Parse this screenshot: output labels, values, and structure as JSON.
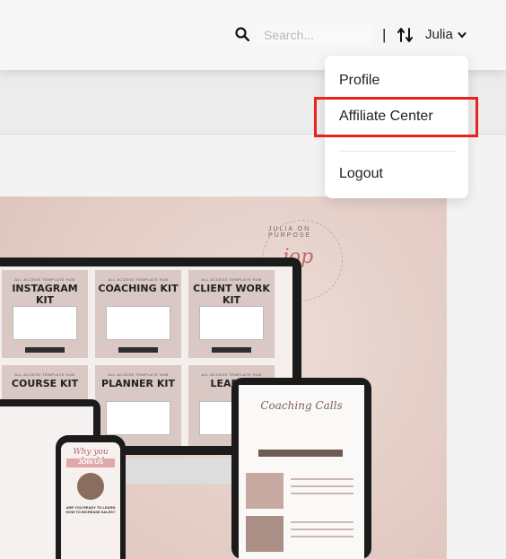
{
  "header": {
    "search_placeholder": "Search...",
    "separator": "|",
    "user_name": "Julia"
  },
  "user_dropdown": {
    "items": [
      {
        "label": "Profile"
      },
      {
        "label": "Affiliate Center"
      },
      {
        "label": "Logout"
      }
    ],
    "highlighted_item": "Affiliate Center",
    "highlight_color": "#e8231c"
  },
  "hero": {
    "seal_text": "JULIA ON PURPOSE",
    "seal_monogram": "jop",
    "kits": [
      {
        "small": "ALL ACCESS TEMPLATE HUB",
        "title": "INSTAGRAM KIT"
      },
      {
        "small": "ALL ACCESS TEMPLATE HUB",
        "title": "COACHING KIT"
      },
      {
        "small": "ALL ACCESS TEMPLATE HUB",
        "title": "CLIENT WORK KIT"
      },
      {
        "small": "ALL ACCESS TEMPLATE HUB",
        "title": "COURSE KIT"
      },
      {
        "small": "ALL ACCESS TEMPLATE HUB",
        "title": "PLANNER KIT"
      },
      {
        "small": "ALL ACCESS TEMPLATE HUB",
        "title": "LEAD M"
      }
    ],
    "phone_heading": "Why you should",
    "phone_join": "JOIN US",
    "phone_question": "ARE YOU READY TO LEARN HOW TO INCREASE SALES?",
    "tablet_title": "Coaching Calls"
  }
}
